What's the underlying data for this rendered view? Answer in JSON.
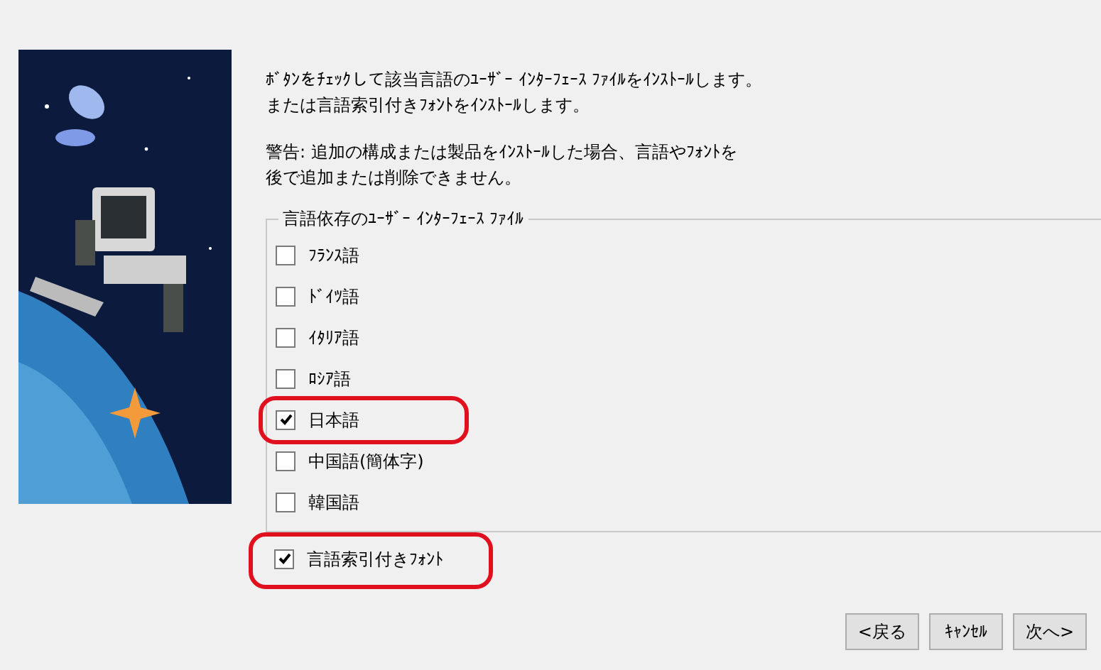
{
  "illustration": {
    "kind": "picture"
  },
  "intro": [
    "ﾎﾞﾀﾝをﾁｪｯｸして該当言語のﾕｰｻﾞｰ ｲﾝﾀｰﾌｪｰｽ ﾌｧｲﾙをｲﾝｽﾄｰﾙします。",
    "または言語索引付きﾌｫﾝﾄをｲﾝｽﾄｰﾙします。"
  ],
  "warning": [
    "警告: 追加の構成または製品をｲﾝｽﾄｰﾙした場合、言語やﾌｫﾝﾄを",
    "後で追加または削除できません。"
  ],
  "group": {
    "title": "言語依存のﾕｰｻﾞｰ ｲﾝﾀｰﾌｪｰｽ ﾌｧｲﾙ",
    "items": [
      {
        "label": "ﾌﾗﾝｽ語",
        "checked": false,
        "highlighted": false
      },
      {
        "label": "ﾄﾞｲﾂ語",
        "checked": false,
        "highlighted": false
      },
      {
        "label": "ｲﾀﾘｱ語",
        "checked": false,
        "highlighted": false
      },
      {
        "label": "ﾛｼｱ語",
        "checked": false,
        "highlighted": false
      },
      {
        "label": "日本語",
        "checked": true,
        "highlighted": true
      },
      {
        "label": "中国語(簡体字)",
        "checked": false,
        "highlighted": false
      },
      {
        "label": "韓国語",
        "checked": false,
        "highlighted": false
      }
    ]
  },
  "font_option": {
    "label": "言語索引付きﾌｫﾝﾄ",
    "checked": true,
    "highlighted": true
  },
  "buttons": [
    "<戻る",
    "ｷｬﾝｾﾙ",
    "次へ>"
  ]
}
